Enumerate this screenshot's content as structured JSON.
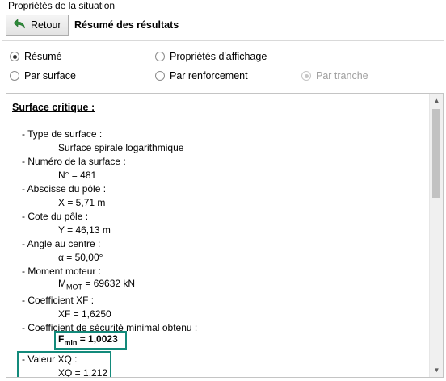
{
  "group": {
    "title": "Propriétés de la situation"
  },
  "header": {
    "back_label": "Retour",
    "title": "Résumé des résultats"
  },
  "radios": [
    {
      "label": "Résumé",
      "selected": true,
      "enabled": true
    },
    {
      "label": "Propriétés d'affichage",
      "selected": false,
      "enabled": true
    },
    {
      "label": "Par surface",
      "selected": false,
      "enabled": true
    },
    {
      "label": "Par renforcement",
      "selected": false,
      "enabled": true
    },
    {
      "label": "Par tranche",
      "selected": true,
      "enabled": false
    }
  ],
  "results": {
    "section_title": "Surface critique :",
    "items": [
      {
        "label": "- Type de surface :",
        "value": "Surface spirale logarithmique"
      },
      {
        "label": "- Numéro de la surface :",
        "value": "N° = 481"
      },
      {
        "label": "- Abscisse du pôle :",
        "value": "X = 5,71 m"
      },
      {
        "label": "- Cote du pôle :",
        "value": "Y = 46,13 m"
      },
      {
        "label": "- Angle au centre :",
        "value": "α = 50,00°"
      },
      {
        "label": "- Moment moteur :",
        "value_main": "M",
        "value_sub": "MOT",
        "value_rest": " = 69632 kN"
      },
      {
        "label": "- Coefficient XF :",
        "value": "XF = 1,6250"
      },
      {
        "label": "- Coefficient de sécurité minimal obtenu :",
        "value_main": "F",
        "value_sub": "min",
        "value_rest": " = 1,0023"
      },
      {
        "label": "- Valeur XQ :",
        "value": "XQ = 1,212"
      }
    ]
  },
  "colors": {
    "highlight": "#138a7b",
    "back_arrow": "#2e8b3a"
  },
  "icons": {
    "back": "back-arrow-icon",
    "scroll_up": "scroll-up-icon",
    "scroll_down": "scroll-down-icon"
  }
}
